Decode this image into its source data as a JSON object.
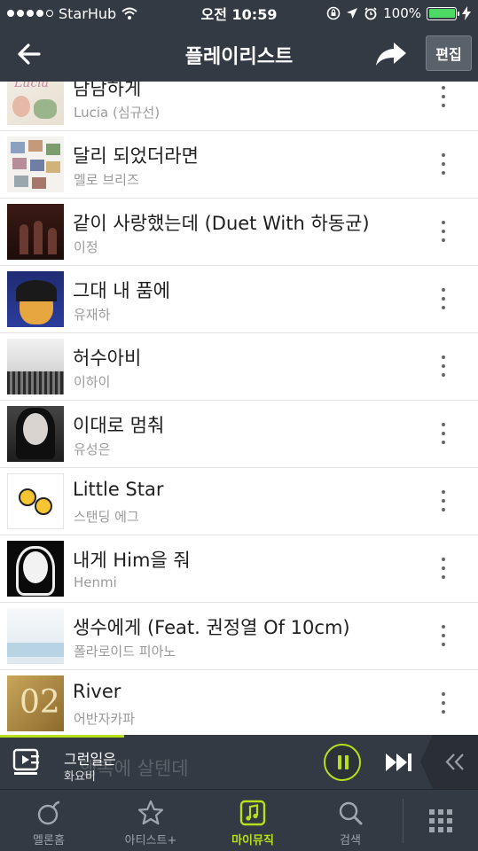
{
  "status_bar": {
    "carrier": "StarHub",
    "time": "오전 10:59",
    "battery": "100%",
    "battery_level": 1.0
  },
  "nav": {
    "title": "플레이리스트",
    "edit_label": "편집",
    "back_icon": "arrow-left-icon",
    "share_icon": "share-arrow-icon"
  },
  "songs": [
    {
      "title": "담담하게",
      "artist": "Lucia (심규선)"
    },
    {
      "title": "달리 되었더라면",
      "artist": "멜로 브리즈"
    },
    {
      "title": "같이 사랑했는데 (Duet With 하동균)",
      "artist": "이정"
    },
    {
      "title": "그대 내 품에",
      "artist": "유재하"
    },
    {
      "title": "허수아비",
      "artist": "이하이"
    },
    {
      "title": "이대로 멈춰",
      "artist": "유성은"
    },
    {
      "title": "Little Star",
      "artist": "스탠딩 에그"
    },
    {
      "title": "내게 Him을 줘",
      "artist": "Henmi"
    },
    {
      "title": "생수에게 (Feat. 권정열 Of 10cm)",
      "artist": "폴라로이드 피아노"
    },
    {
      "title": "River",
      "artist": "어반자카파"
    }
  ],
  "album_art_text": {
    "song1": "Lucia",
    "song10": "02"
  },
  "mini_player": {
    "title": "그런일은",
    "artist": "화요비",
    "obscured_row_title": "행복에 살텐데",
    "progress": 0.26
  },
  "tabs": [
    {
      "label": "멜론홈",
      "icon": "melon-icon"
    },
    {
      "label": "아티스트+",
      "icon": "star-icon"
    },
    {
      "label": "마이뮤직",
      "icon": "music-note-icon",
      "active": true
    },
    {
      "label": "검색",
      "icon": "search-icon"
    }
  ],
  "colors": {
    "bar_bg": "#343a44",
    "accent": "#b6e11a"
  }
}
